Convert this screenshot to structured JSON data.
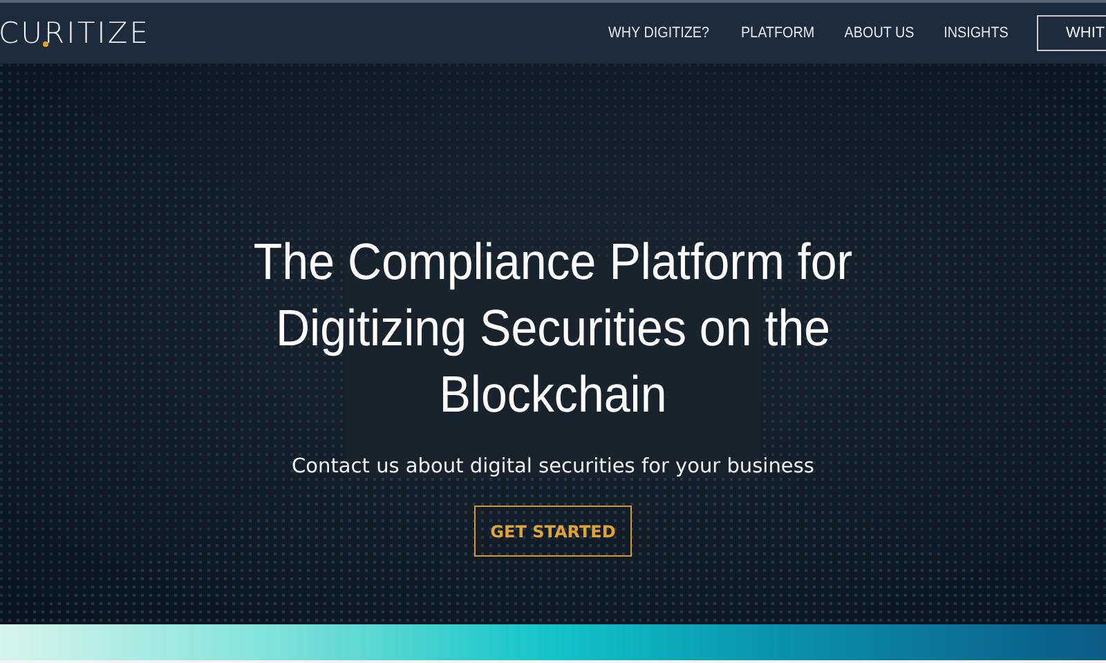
{
  "header": {
    "logo": "CURITIZE",
    "nav": [
      {
        "label": "WHY DIGITIZE?"
      },
      {
        "label": "PLATFORM"
      },
      {
        "label": "ABOUT US"
      },
      {
        "label": "INSIGHTS"
      }
    ],
    "cta": "WHIT"
  },
  "hero": {
    "kind": "picture",
    "title": "The Compliance Platform for Digitizing Securities on the Blockchain",
    "subtitle": "Contact us about digital securities for your business",
    "button": "GET STARTED"
  }
}
